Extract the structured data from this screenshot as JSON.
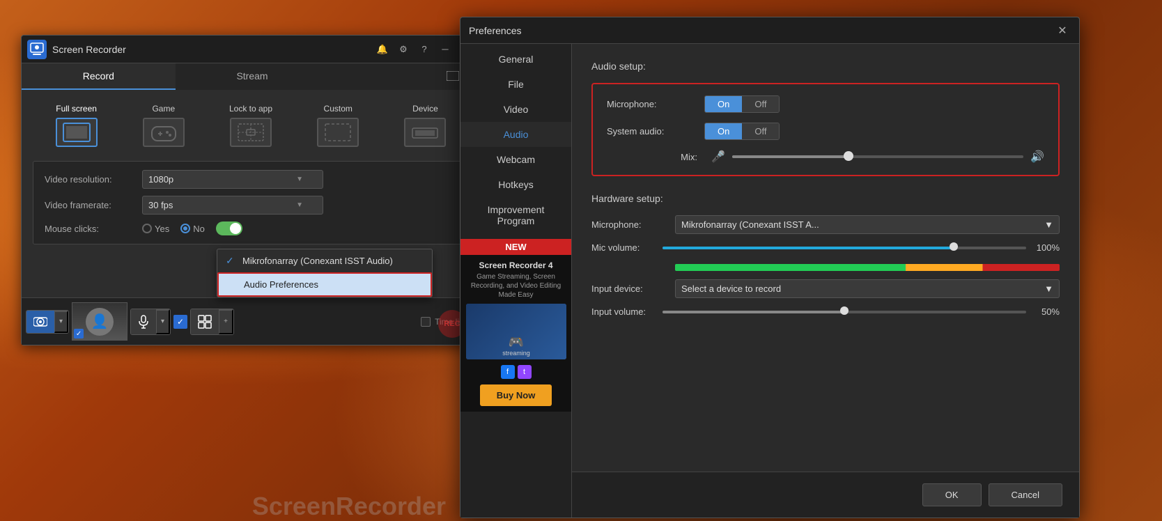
{
  "background": {
    "description": "autumn pumpkin background"
  },
  "sr_window": {
    "title": "Screen Recorder",
    "logo_text": "►",
    "tabs": [
      {
        "label": "Record",
        "active": true
      },
      {
        "label": "Stream",
        "active": false
      }
    ],
    "modes": [
      {
        "label": "Full screen",
        "active": true,
        "icon": "⬛"
      },
      {
        "label": "Game",
        "active": false,
        "icon": "🎮"
      },
      {
        "label": "Lock to app",
        "active": false,
        "icon": "⊞"
      },
      {
        "label": "Custom",
        "active": false,
        "icon": "⬜"
      },
      {
        "label": "Device",
        "active": false,
        "icon": "━"
      }
    ],
    "settings": {
      "video_resolution_label": "Video resolution:",
      "video_resolution_value": "1080p",
      "video_framerate_label": "Video framerate:",
      "video_framerate_value": "30 fps",
      "mouse_clicks_label": "Mouse clicks:",
      "mouse_yes": "Yes",
      "mouse_no": "No"
    },
    "bottom_bar": {
      "time_limit_label": "Time limit"
    },
    "dropdown_menu": {
      "items": [
        {
          "label": "Mikrofonarray (Conexant ISST Audio)",
          "checked": true
        },
        {
          "label": "Audio Preferences",
          "highlighted": true
        }
      ]
    }
  },
  "preferences": {
    "title": "Preferences",
    "nav_items": [
      {
        "label": "General"
      },
      {
        "label": "File"
      },
      {
        "label": "Video"
      },
      {
        "label": "Audio",
        "active": true
      },
      {
        "label": "Webcam"
      },
      {
        "label": "Hotkeys"
      },
      {
        "label": "Improvement Program"
      }
    ],
    "ad": {
      "badge": "NEW",
      "title": "Screen Recorder 4",
      "subtitle": "Game Streaming, Screen Recording, and Video Editing Made Easy",
      "buy_label": "Buy Now"
    },
    "content": {
      "audio_setup_label": "Audio setup:",
      "microphone_label": "Microphone:",
      "microphone_on": "On",
      "microphone_off": "Off",
      "microphone_on_active": true,
      "microphone_off_active": false,
      "system_audio_label": "System audio:",
      "system_audio_on": "On",
      "system_audio_off": "Off",
      "system_audio_on_active": true,
      "system_audio_off_active": false,
      "mix_label": "Mix:",
      "hardware_setup_label": "Hardware setup:",
      "hw_microphone_label": "Microphone:",
      "hw_microphone_value": "Mikrofonarray (Conexant ISST A...",
      "mic_volume_label": "Mic volume:",
      "mic_volume_value": "100%",
      "input_device_label": "Input device:",
      "input_device_value": "Select a device to record",
      "input_volume_label": "Input volume:",
      "input_volume_value": "50%"
    },
    "footer": {
      "ok_label": "OK",
      "cancel_label": "Cancel"
    }
  },
  "watermark": {
    "text": "ScreenRecorder"
  }
}
